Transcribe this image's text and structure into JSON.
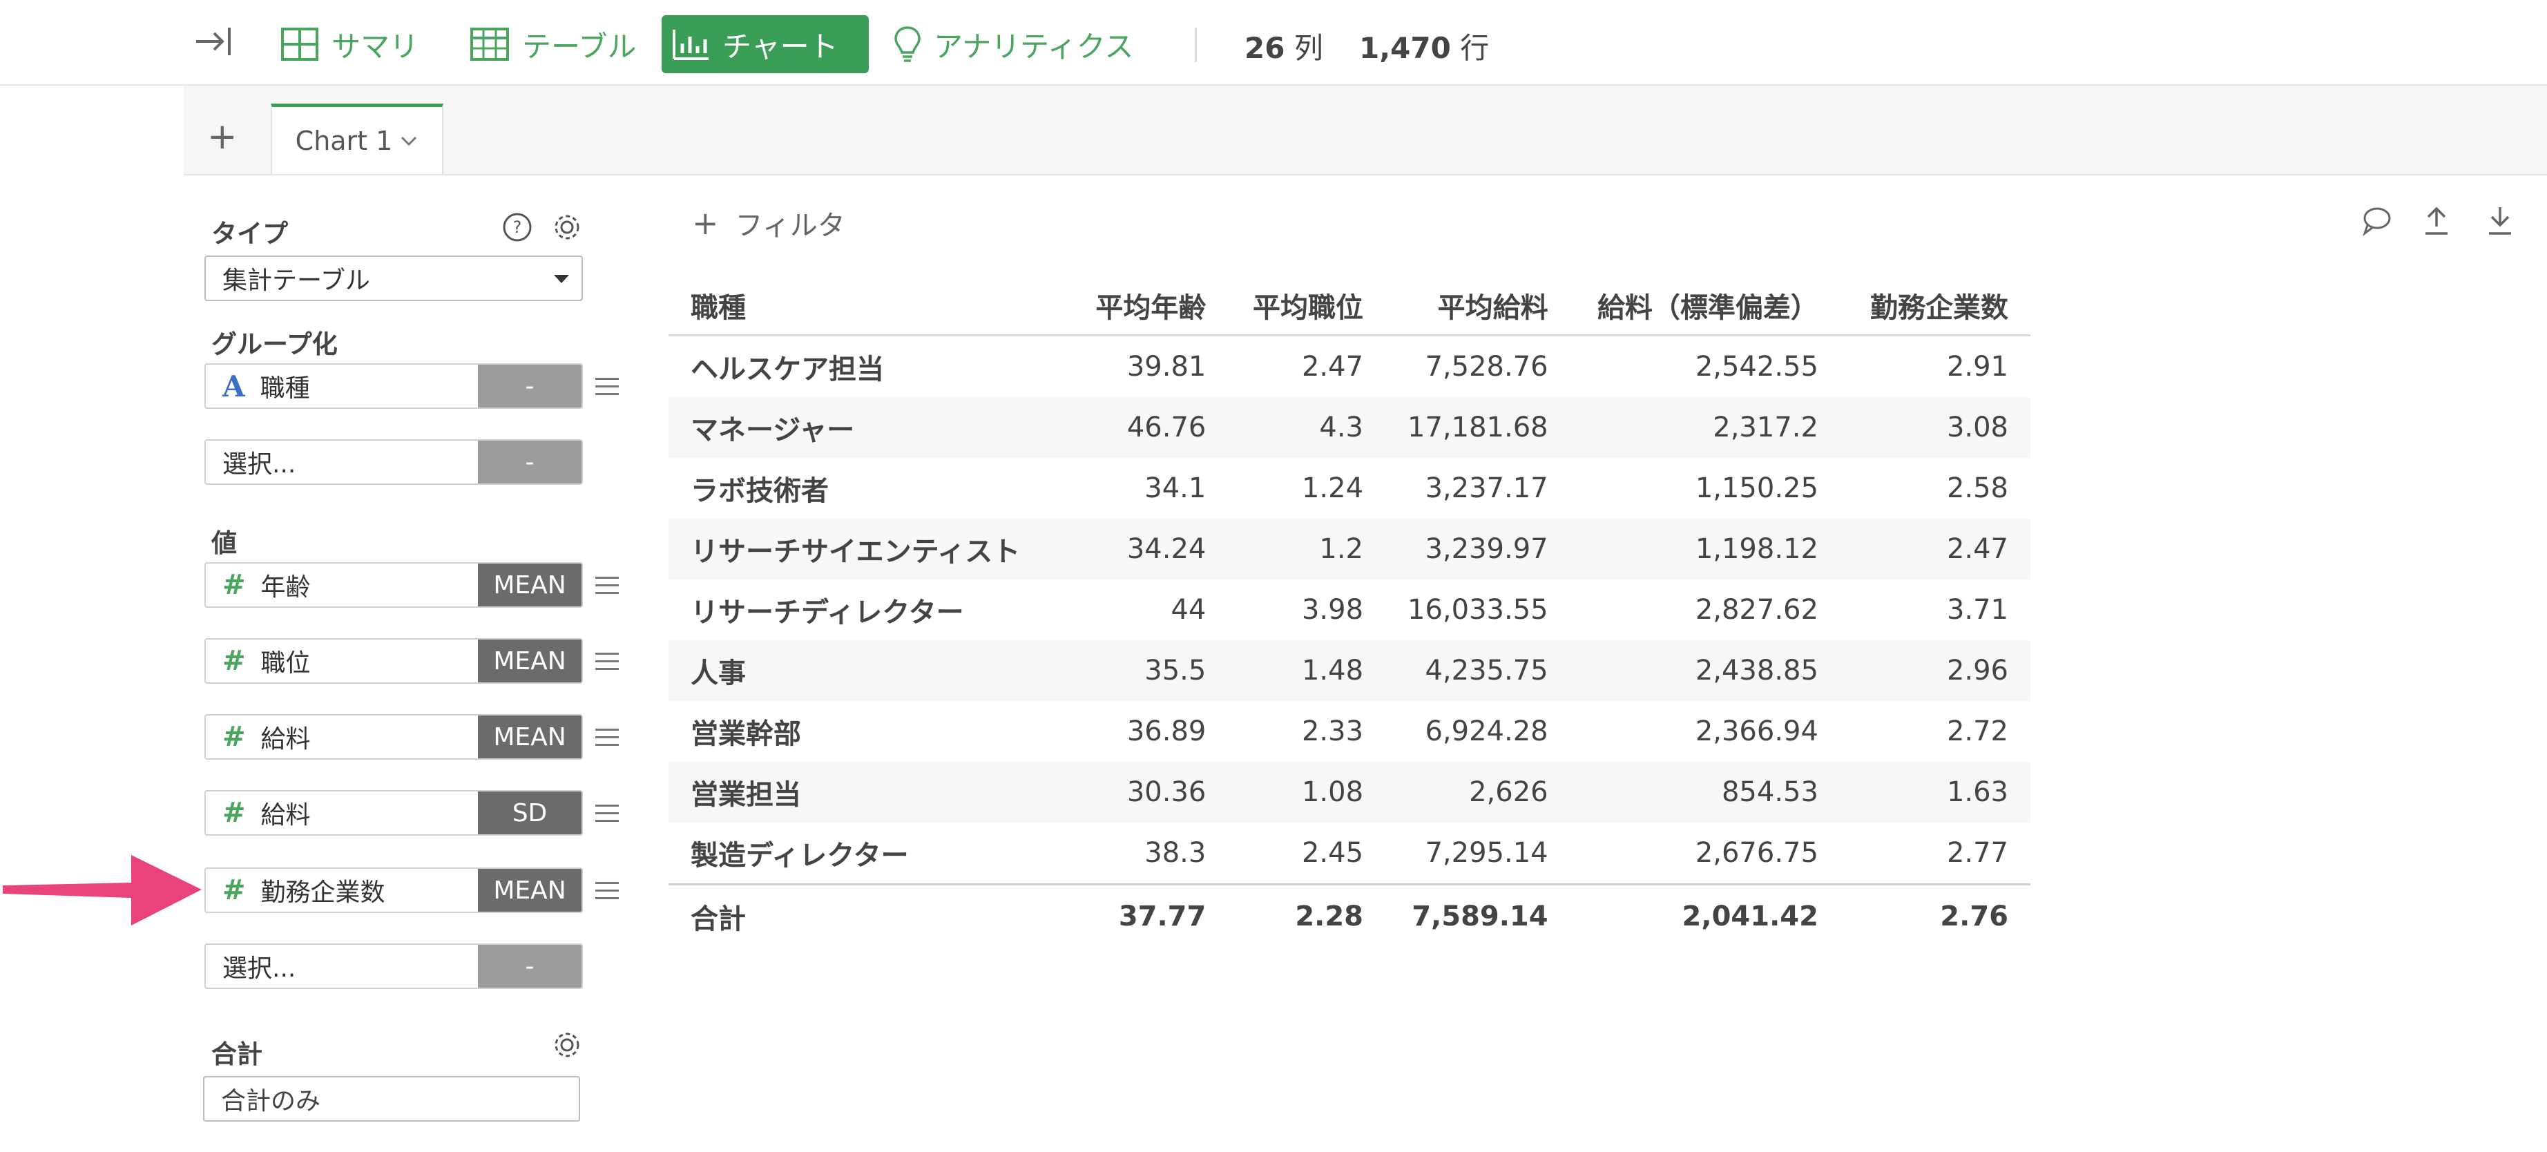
{
  "toolbar": {
    "tabs": [
      {
        "label": "サマリ",
        "icon": "grid-icon"
      },
      {
        "label": "テーブル",
        "icon": "table-icon"
      },
      {
        "label": "チャート",
        "icon": "bar-chart-icon",
        "active": true
      },
      {
        "label": "アナリティクス",
        "icon": "lightbulb-icon"
      }
    ],
    "columns_count": "26",
    "columns_unit": "列",
    "rows_count": "1,470",
    "rows_unit": "行"
  },
  "tabstrip": {
    "add_label": "+",
    "chart_tab_label": "Chart 1"
  },
  "left_panel": {
    "type_label": "タイプ",
    "type_value": "集計テーブル",
    "group_label": "グループ化",
    "group_fields": [
      {
        "name": "職種",
        "agg": "-",
        "icon": "text-type-icon"
      }
    ],
    "group_select_placeholder": "選択...",
    "group_select_agg": "-",
    "values_label": "値",
    "value_fields": [
      {
        "name": "年齢",
        "agg": "MEAN"
      },
      {
        "name": "職位",
        "agg": "MEAN"
      },
      {
        "name": "給料",
        "agg": "MEAN"
      },
      {
        "name": "給料",
        "agg": "SD"
      },
      {
        "name": "勤務企業数",
        "agg": "MEAN"
      }
    ],
    "value_select_placeholder": "選択...",
    "value_select_agg": "-",
    "total_label": "合計",
    "total_value": "合計のみ"
  },
  "main": {
    "filter_label": "フィルタ",
    "table": {
      "headers": [
        "職種",
        "平均年齢",
        "平均職位",
        "平均給料",
        "給料（標準偏差）",
        "勤務企業数"
      ],
      "rows": [
        [
          "ヘルスケア担当",
          "39.81",
          "2.47",
          "7,528.76",
          "2,542.55",
          "2.91"
        ],
        [
          "マネージャー",
          "46.76",
          "4.3",
          "17,181.68",
          "2,317.2",
          "3.08"
        ],
        [
          "ラボ技術者",
          "34.1",
          "1.24",
          "3,237.17",
          "1,150.25",
          "2.58"
        ],
        [
          "リサーチサイエンティスト",
          "34.24",
          "1.2",
          "3,239.97",
          "1,198.12",
          "2.47"
        ],
        [
          "リサーチディレクター",
          "44",
          "3.98",
          "16,033.55",
          "2,827.62",
          "3.71"
        ],
        [
          "人事",
          "35.5",
          "1.48",
          "4,235.75",
          "2,438.85",
          "2.96"
        ],
        [
          "営業幹部",
          "36.89",
          "2.33",
          "6,924.28",
          "2,366.94",
          "2.72"
        ],
        [
          "営業担当",
          "30.36",
          "1.08",
          "2,626",
          "854.53",
          "1.63"
        ],
        [
          "製造ディレクター",
          "38.3",
          "2.45",
          "7,295.14",
          "2,676.75",
          "2.77"
        ]
      ],
      "total": [
        "合計",
        "37.77",
        "2.28",
        "7,589.14",
        "2,041.42",
        "2.76"
      ]
    }
  },
  "colors": {
    "accent": "#3a9e57",
    "agg_badge": "#6b6b6b",
    "arrow": "#e8437a"
  }
}
